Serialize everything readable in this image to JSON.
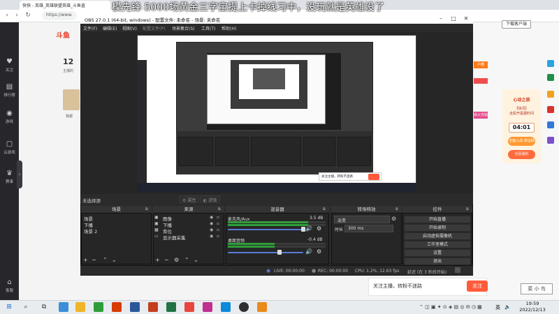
{
  "browser": {
    "tab_title": "快快 - 英雄_英雄联盟英雄_斗鱼直",
    "url": "https://www.",
    "download_btn": "下载客户端",
    "danmaku": "模先锋 5000场黄金三字宝提上卡掉线习中，没玩就是英雄没了"
  },
  "sidebar": {
    "items": [
      {
        "icon": "♥",
        "label": "关注"
      },
      {
        "icon": "▤",
        "label": "排行榜"
      },
      {
        "icon": "◉",
        "label": "游戏"
      },
      {
        "icon": "▢",
        "label": "云游戏"
      },
      {
        "icon": "♛",
        "label": "赛事"
      },
      {
        "icon": "⌂",
        "label": "客服"
      }
    ]
  },
  "webpage": {
    "logo": "斗鱼",
    "stat_num": "12",
    "stat_sub": "主播的",
    "thumb_label": "我都",
    "promo_tag1": "户晒",
    "promo_tag3": "会火光始",
    "promo_title": "心动之旅",
    "promo_sub": "【快讯】\n全民开黑报时间",
    "promo_date": "04:01",
    "promo_btn1": "全面入战 幸运抽奖",
    "promo_btn2": "全民福利",
    "follow_text": "关注主播，转粉不迷路",
    "follow_btn": "关注",
    "watermark": "菜 小 鸟"
  },
  "obs": {
    "title": "OBS 27.0.1 (64-bit, windows) - 配置文件: 未命名 - 场景: 未命名",
    "menu": [
      "文件(F)",
      "编辑(E)",
      "视图(V)",
      "配置文件(P)",
      "场景集合(S)",
      "工具(T)",
      "帮助(H)"
    ],
    "no_source": "未选择源",
    "props_btn": "属性",
    "filters_btn": "滤镜",
    "nested_popup": "关注主播，转粉不迷路",
    "docks": {
      "scenes": "场景",
      "sources": "来源",
      "mixer": "混音器",
      "transitions": "转场特效",
      "controls": "控件"
    },
    "scenes": [
      "场景",
      "下播",
      "场景 2"
    ],
    "sources": [
      {
        "icon": "▣",
        "name": "图像"
      },
      {
        "icon": "▣",
        "name": "下播"
      },
      {
        "icon": "▦",
        "name": "背位"
      },
      {
        "icon": "▭",
        "name": "显示器采集"
      }
    ],
    "mixer": [
      {
        "name": "麦克风/Aux",
        "db": "3.5 dB",
        "level": 0.82
      },
      {
        "name": "桌面音频",
        "db": "-0.4 dB",
        "level": 0.48
      }
    ],
    "transition": {
      "type": "淡变",
      "duration_label": "时长",
      "duration": "300 ms"
    },
    "controls": [
      "开始直播",
      "开始录制",
      "启动虚拟摄像机",
      "工作室模式",
      "设置",
      "退出"
    ],
    "status": {
      "live": "LIVE: 00:00:00",
      "rec": "REC: 00:00:00",
      "cpu": "CPU: 1.2%, 12.63 fps",
      "delay": "延迟 (在 3 秒后开始)"
    }
  },
  "taskbar": {
    "ime": "英",
    "time": "19:59",
    "date": "2022/12/13"
  }
}
